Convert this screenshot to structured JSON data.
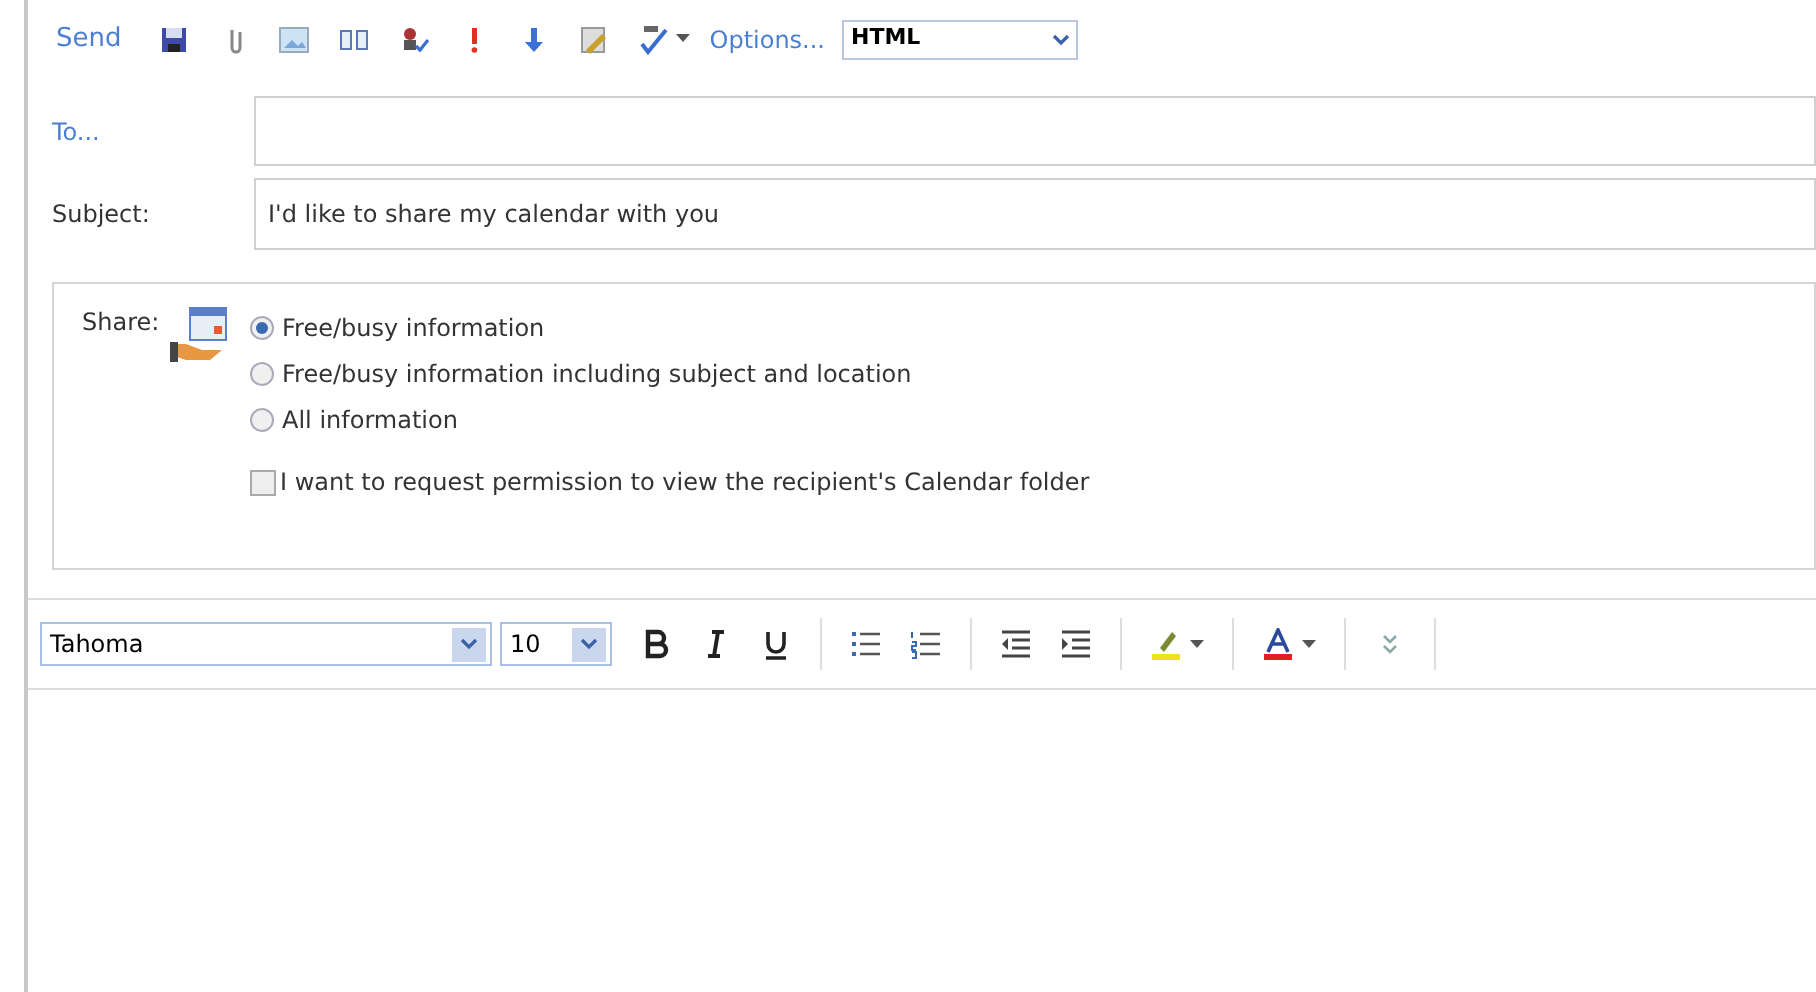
{
  "toolbar": {
    "send": "Send",
    "options": "Options...",
    "format": "HTML"
  },
  "to": {
    "label": "To..."
  },
  "subject": {
    "label": "Subject:",
    "value": "I'd like to share my calendar with you"
  },
  "share": {
    "label": "Share:",
    "options": [
      {
        "label": "Free/busy information",
        "selected": true
      },
      {
        "label": "Free/busy information including subject and location",
        "selected": false
      },
      {
        "label": "All information",
        "selected": false
      }
    ],
    "request": {
      "label": "I want to request permission to view the recipient's Calendar folder",
      "checked": false
    }
  },
  "format_bar": {
    "font": "Tahoma",
    "size": "10"
  }
}
